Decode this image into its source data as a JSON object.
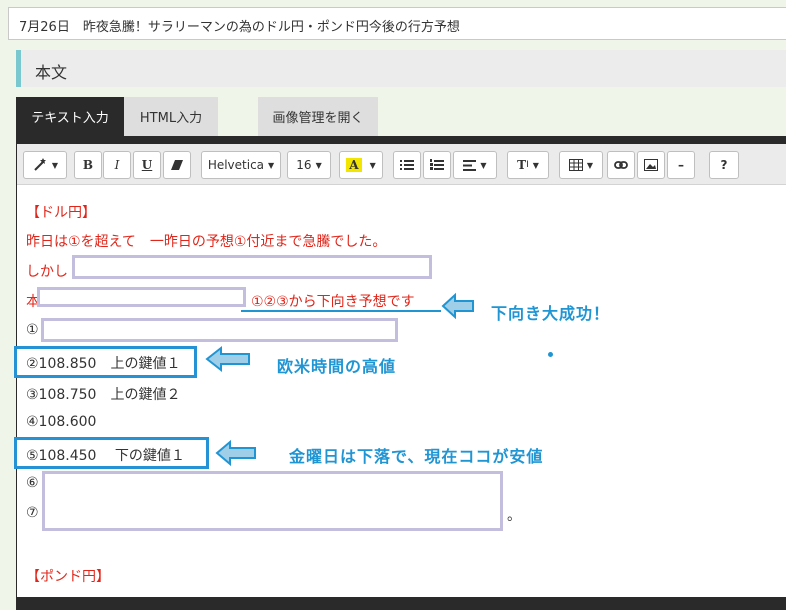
{
  "title_field": {
    "value": "7月26日　昨夜急騰！サラリーマンの為のドル円・ポンド円今後の行方予想"
  },
  "section": {
    "heading": "本文"
  },
  "tabs": {
    "text_input": "テキスト入力",
    "html_input": "HTML入力",
    "image_manager": "画像管理を開く"
  },
  "toolbar": {
    "font_name": "Helvetica",
    "font_size": "16",
    "text_color_glyph": "A",
    "bold": "B",
    "italic": "I",
    "underline": "U",
    "style_glyph": "T",
    "help": "?",
    "remove": "–"
  },
  "content": {
    "dollar_heading": "【ドル円】",
    "line1": "昨日は①を超えて　一昨日の予想①付近まで急騰でした。",
    "line2_prefix": "しかし",
    "line3_prefix": "本",
    "line3_suffix": "①②③から下向き予想です",
    "item1": "①",
    "item2": "②108.850　上の鍵値１",
    "item3": "③108.750　上の鍵値２",
    "item4": "④108.600",
    "item5": "⑤108.450　 下の鍵値１",
    "item6": "⑥",
    "item7": "⑦",
    "item7_end": "。",
    "pound_heading": "【ポンド円】"
  },
  "annotations": {
    "down_success": "下向き大成功！",
    "europe_high": "欧米時間の高値",
    "friday_low": "金曜日は下落で、現在ココが安値"
  },
  "colors": {
    "accent": "#79c7cf",
    "annotation_blue": "#1f95d4",
    "red_text": "#e0261a",
    "mask_border": "#c3bedd"
  }
}
